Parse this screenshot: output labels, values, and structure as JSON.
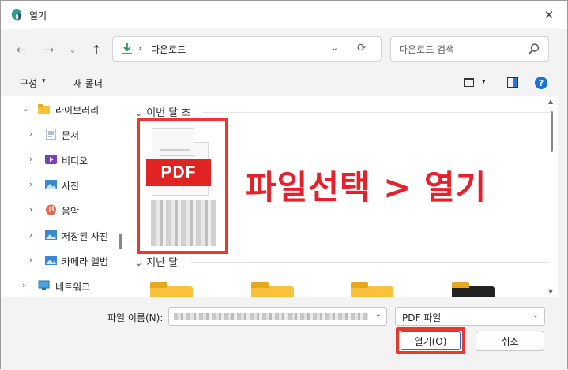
{
  "window": {
    "title": "열기",
    "close_glyph": "✕"
  },
  "nav": {
    "back": "←",
    "forward": "→",
    "recent": "⌄",
    "up": "↑"
  },
  "address": {
    "separator": "›",
    "path": "다운로드",
    "dropdown": "⌄",
    "refresh": "⟳"
  },
  "search": {
    "placeholder": "다운로드 검색"
  },
  "toolbar": {
    "organize": "구성",
    "organize_caret": "▾",
    "new_folder": "새 폴더",
    "view_caret": "▾",
    "help": "?"
  },
  "sidebar": {
    "items": [
      {
        "label": "라이브러리",
        "chev": "⌄",
        "icon": "library"
      },
      {
        "label": "문서",
        "chev": "›",
        "icon": "documents"
      },
      {
        "label": "비디오",
        "chev": "›",
        "icon": "videos"
      },
      {
        "label": "사진",
        "chev": "›",
        "icon": "pictures"
      },
      {
        "label": "음악",
        "chev": "›",
        "icon": "music"
      },
      {
        "label": "저장된 사진",
        "chev": "›",
        "icon": "saved-pictures"
      },
      {
        "label": "카메라 앨범",
        "chev": "›",
        "icon": "camera-roll"
      },
      {
        "label": "네트워크",
        "chev": "›",
        "icon": "network"
      }
    ]
  },
  "content": {
    "group1": {
      "chev": "⌄",
      "label": "이번 달 초"
    },
    "group2": {
      "chev": "⌄",
      "label": "지난 달"
    },
    "pdf_badge": "PDF",
    "overlay": "파일선택 > 열기"
  },
  "bottom": {
    "filename_label": "파일 이름(N):",
    "filename_caret": "⌄",
    "filetype": "PDF 파일",
    "filetype_caret": "⌄",
    "open": "열기(O)",
    "cancel": "취소"
  },
  "colors": {
    "accent": "#1a73d9",
    "highlight": "#e8382f",
    "pdf_red": "#e02323",
    "folder": "#f8c23a"
  }
}
